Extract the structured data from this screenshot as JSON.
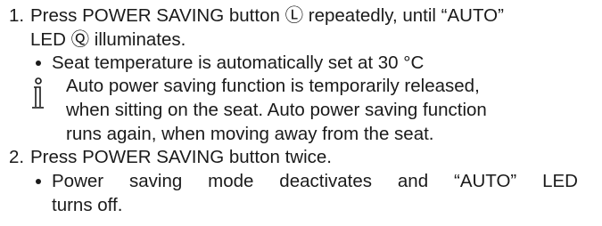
{
  "steps": [
    {
      "number": "1.",
      "lines": [
        "Press POWER SAVING button Ⓛ repeatedly, until “AUTO”",
        "LED Ⓠ illuminates."
      ],
      "bullets": [
        {
          "lines": [
            "Seat temperature is automatically set at 30 °C"
          ]
        }
      ],
      "note": {
        "icon": "info-icon",
        "lines": [
          "Auto power saving function is temporarily released,",
          "when sitting on the seat. Auto power saving function",
          "runs again, when moving away from the seat."
        ]
      }
    },
    {
      "number": "2.",
      "lines": [
        "Press POWER SAVING button twice."
      ],
      "bullets": [
        {
          "lines": [
            "Power saving mode deactivates and “AUTO” LED",
            "turns   off."
          ]
        }
      ]
    }
  ]
}
